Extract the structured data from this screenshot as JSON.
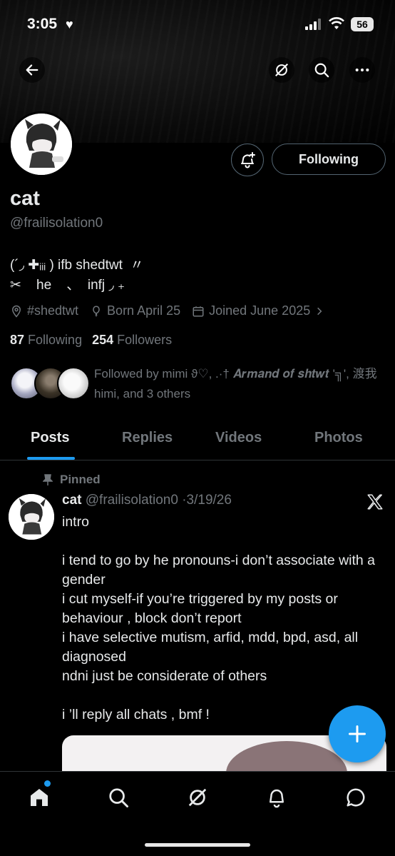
{
  "status_bar": {
    "time": "3:05",
    "battery": "56"
  },
  "profile": {
    "name": "cat",
    "handle": "@frailisolation0",
    "bio_line1": "(´◞ ✚ᵢᵢᵢ ) ifb shedtwt  〃",
    "bio_line2": "✂︎    he    、  infj ◞ ₊",
    "location": "#shedtwt",
    "birthday": "Born April 25",
    "joined": "Joined June 2025",
    "following_count": "87",
    "following_label": "Following",
    "followers_count": "254",
    "followers_label": "Followers",
    "followed_by": "Followed by mimi ϑ♡, .·† 𝑨𝒓𝒎𝒂𝒏𝒅 𝒐𝒇 𝒔𝒉𝒕𝒘𝒕 '╗', 渡我 himi, and 3 others"
  },
  "actions": {
    "follow_label": "Following"
  },
  "tabs": [
    {
      "label": "Posts"
    },
    {
      "label": "Replies"
    },
    {
      "label": "Videos"
    },
    {
      "label": "Photos"
    }
  ],
  "post": {
    "pinned_label": "Pinned",
    "author_name": "cat",
    "author_handle": "@frailisolation0",
    "date": "3/19/26",
    "text": "intro\n\ni tend to go by he pronouns-i don’t associate with a gender\ni cut myself-if you’re triggered by my posts or behaviour , block don’t report\ni have selective mutism, arfid, mdd, bpd, asd, all diagnosed\nndni just be considerate of others\n\ni ’ll reply all chats , bmf !"
  },
  "colors": {
    "accent": "#1d9bf0",
    "muted": "#71767b",
    "text": "#e7e9ea",
    "border": "#2f3336"
  },
  "icons": [
    "back-arrow-icon",
    "grok-icon",
    "search-icon",
    "more-icon",
    "notification-bell-plus-icon",
    "location-icon",
    "balloon-icon",
    "calendar-icon",
    "pin-icon",
    "x-logo-icon",
    "plus-icon",
    "home-icon",
    "explore-icon",
    "notifications-icon",
    "messages-icon"
  ]
}
